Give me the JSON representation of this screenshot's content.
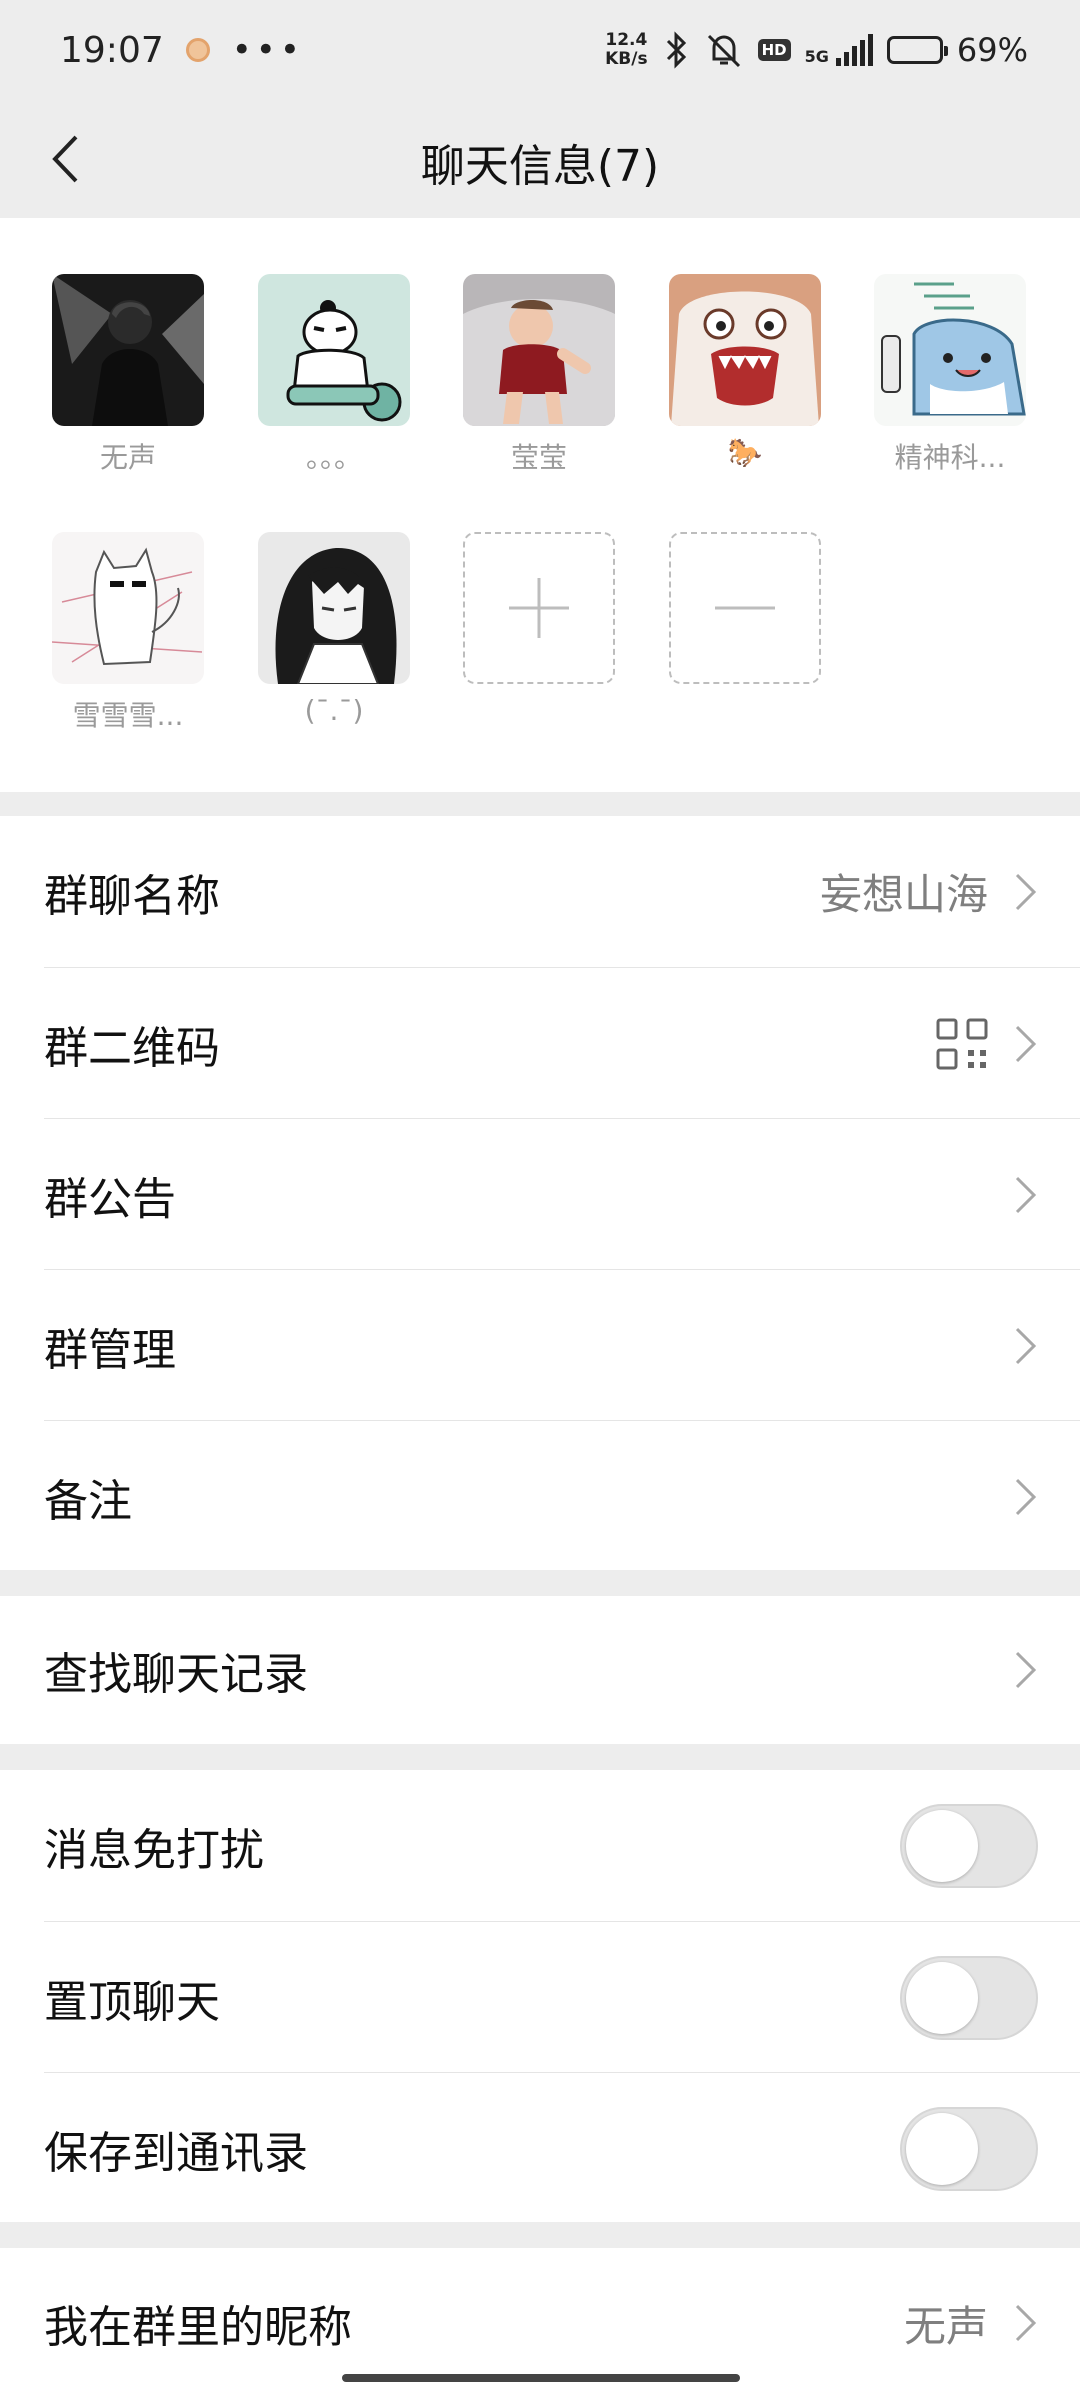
{
  "status_bar": {
    "time": "19:07",
    "more": "•••",
    "speed_value": "12.4",
    "speed_unit": "KB/s",
    "hd": "HD",
    "network": "5G",
    "battery_percent": "69%",
    "battery_level": 0.69
  },
  "header": {
    "title": "聊天信息(7)"
  },
  "members": [
    {
      "name": "无声"
    },
    {
      "name": "。。。"
    },
    {
      "name": "莹莹"
    },
    {
      "name": "🐎"
    },
    {
      "name": "精神科..."
    },
    {
      "name": "雪雪雪..."
    },
    {
      "name": "(ˉ.ˉ)"
    }
  ],
  "settings": {
    "group_name_label": "群聊名称",
    "group_name_value": "妄想山海",
    "qrcode_label": "群二维码",
    "announcement_label": "群公告",
    "manage_label": "群管理",
    "remark_label": "备注",
    "search_history_label": "查找聊天记录",
    "mute_label": "消息免打扰",
    "pin_label": "置顶聊天",
    "save_contacts_label": "保存到通讯录",
    "nickname_label": "我在群里的昵称",
    "nickname_value": "无声"
  },
  "toggles": {
    "mute": false,
    "pin": false,
    "save_contacts": false
  },
  "colors": {
    "background": "#ededed",
    "card": "#ffffff",
    "secondary_text": "#7f7f7f"
  }
}
